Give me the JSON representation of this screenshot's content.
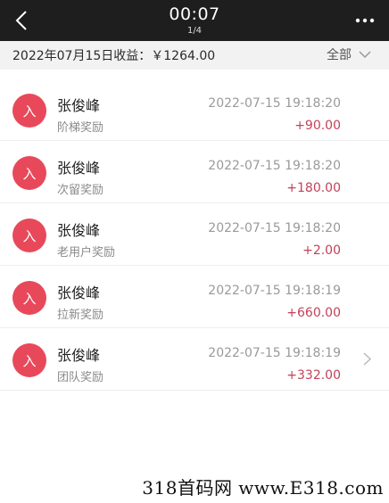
{
  "header": {
    "time": "00:07",
    "pager": "1/4",
    "back_icon": "chevron-left-icon",
    "more_icon": "more-dots-icon"
  },
  "summary": {
    "text": "2022年07月15日收益：￥1264.00",
    "filter_label": "全部",
    "filter_icon": "chevron-down-icon"
  },
  "records": [
    {
      "avatar": "入",
      "name": "张俊峰",
      "type": "阶梯奖励",
      "datetime": "2022-07-15 19:18:20",
      "amount": "+90.00"
    },
    {
      "avatar": "入",
      "name": "张俊峰",
      "type": "次留奖励",
      "datetime": "2022-07-15 19:18:20",
      "amount": "+180.00"
    },
    {
      "avatar": "入",
      "name": "张俊峰",
      "type": "老用户奖励",
      "datetime": "2022-07-15 19:18:20",
      "amount": "+2.00"
    },
    {
      "avatar": "入",
      "name": "张俊峰",
      "type": "拉新奖励",
      "datetime": "2022-07-15 19:18:19",
      "amount": "+660.00"
    },
    {
      "avatar": "入",
      "name": "张俊峰",
      "type": "团队奖励",
      "datetime": "2022-07-15 19:18:19",
      "amount": "+332.00"
    }
  ],
  "watermark": "318首码网 www.E318.com",
  "colors": {
    "topbar": "#1e1e1e",
    "avatar": "#e8495a",
    "amount": "#c3405a"
  }
}
